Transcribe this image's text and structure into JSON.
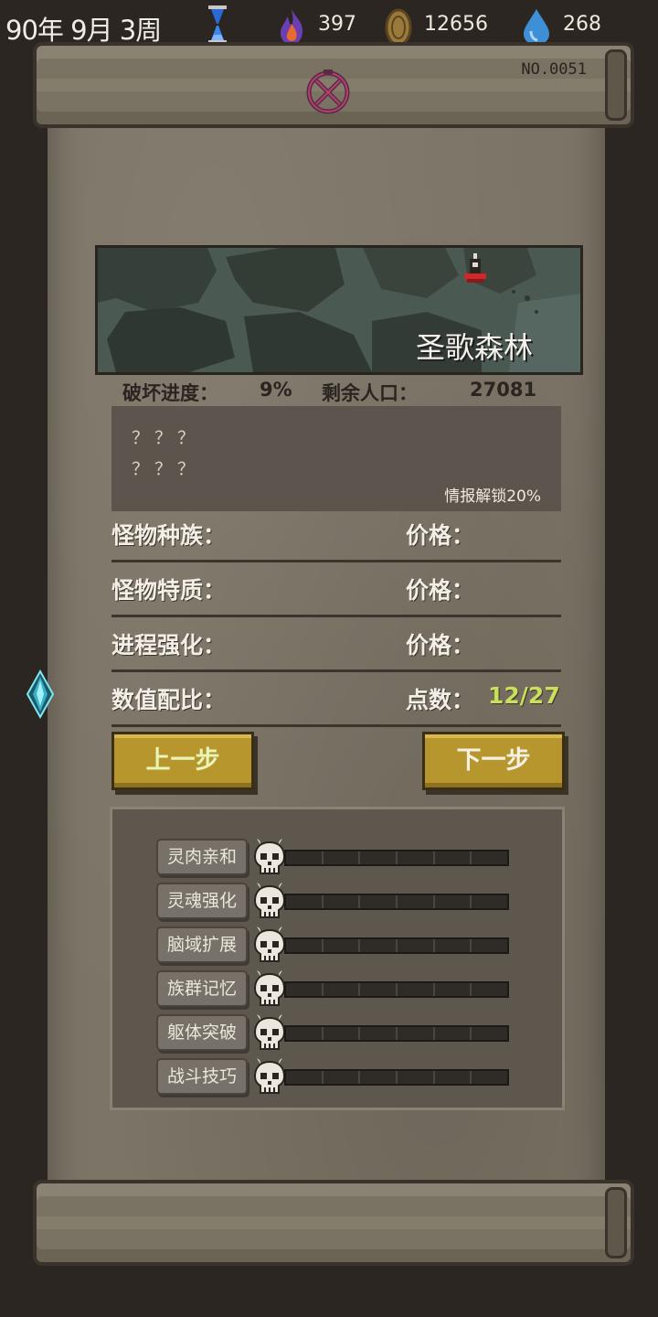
{
  "topbar": {
    "date": "90年 9月 3周",
    "resources": [
      {
        "icon": "fire-icon",
        "value": "397"
      },
      {
        "icon": "coin-icon",
        "value": "12656"
      },
      {
        "icon": "water-drop-icon",
        "value": "268"
      }
    ]
  },
  "serial": "NO.0051",
  "map": {
    "name": "圣歌森林"
  },
  "stats": {
    "destruction_label": "破坏进度：",
    "destruction_value": "9%",
    "population_label": "剩余人口：",
    "population_value": "27081"
  },
  "intel": {
    "line1": "？？？",
    "line2": "？？？",
    "unlock": "情报解锁20%"
  },
  "rows": [
    {
      "label": "怪物种族：",
      "right": "价格："
    },
    {
      "label": "怪物特质：",
      "right": "价格："
    },
    {
      "label": "进程强化：",
      "right": "价格："
    },
    {
      "label": "数值配比：",
      "right": "点数：",
      "points": "12/27"
    }
  ],
  "buttons": {
    "prev": "上一步",
    "next": "下一步"
  },
  "attributes": [
    {
      "label": "灵肉亲和",
      "level": 0,
      "max": 6
    },
    {
      "label": "灵魂强化",
      "level": 0,
      "max": 6
    },
    {
      "label": "脑域扩展",
      "level": 0,
      "max": 6
    },
    {
      "label": "族群记忆",
      "level": 0,
      "max": 6
    },
    {
      "label": "躯体突破",
      "level": 0,
      "max": 6
    },
    {
      "label": "战斗技巧",
      "level": 0,
      "max": 6
    }
  ],
  "colors": {
    "points_green": "#c9e05a",
    "button_gold": "#b8962e"
  }
}
